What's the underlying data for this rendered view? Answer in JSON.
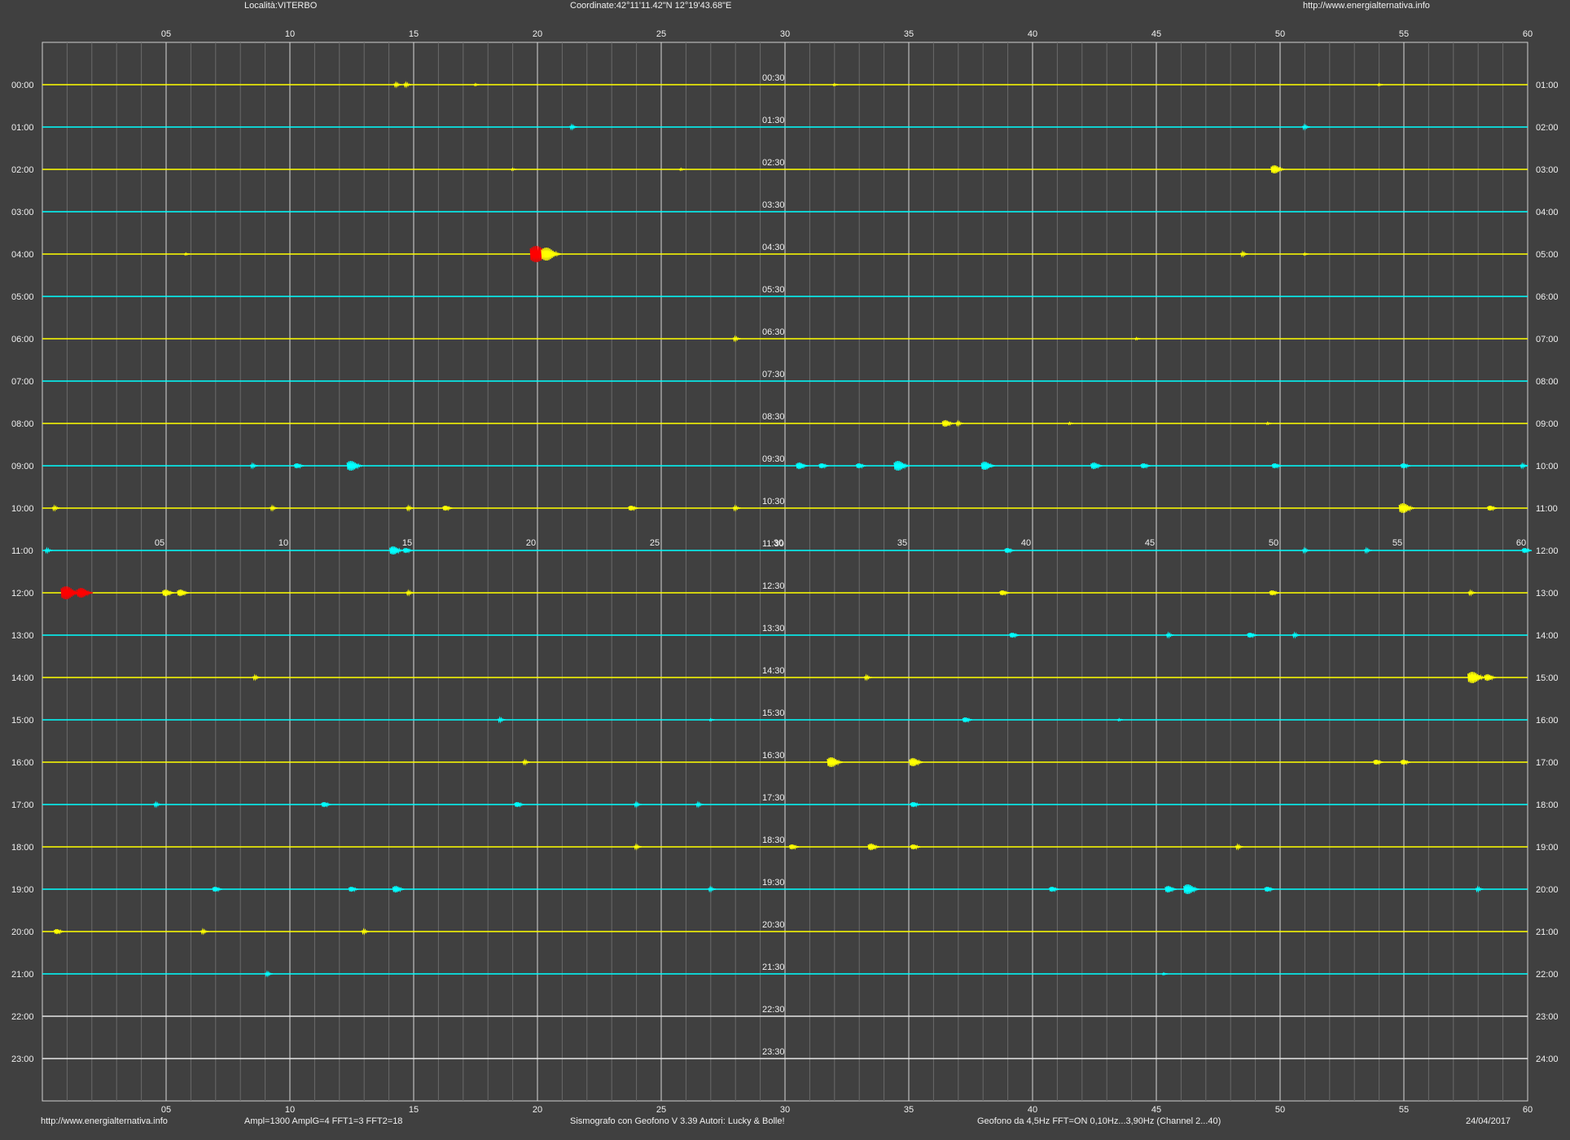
{
  "header": {
    "location": "Località:VITERBO",
    "coordinates": "Coordinate:42°11'11.42\"N  12°19'43.68\"E",
    "website": "http://www.energialternativa.info"
  },
  "footer": {
    "website": "http://www.energialternativa.info",
    "amplification": "Ampl=1300 AmplG=4 FFT1=3 FFT2=18",
    "software": "Sismografo con Geofono V 3.39  Autori: Lucky & Bolle!",
    "sensor": "Geofono da 4,5Hz FFT=ON 0,10Hz...3,90Hz      (Channel 2...40)",
    "date": "24/04/2017"
  },
  "colors": {
    "background": "#404040",
    "trace_a": "#ffff00",
    "trace_b": "#00ffff",
    "event": "#ff0000",
    "empty_trace": "#e6e6e6",
    "grid_major": "#d9d9d9",
    "grid_minor": "#6a6a6a"
  },
  "chart_data": {
    "type": "line",
    "x_tick_labels": [
      "05",
      "10",
      "15",
      "20",
      "25",
      "30",
      "35",
      "40",
      "45",
      "50",
      "55",
      "60"
    ],
    "xlim": [
      0,
      60
    ],
    "left_labels": [
      "00:00",
      "01:00",
      "02:00",
      "03:00",
      "04:00",
      "05:00",
      "06:00",
      "07:00",
      "08:00",
      "09:00",
      "10:00",
      "11:00",
      "12:00",
      "13:00",
      "14:00",
      "15:00",
      "16:00",
      "17:00",
      "18:00",
      "19:00",
      "20:00",
      "21:00",
      "22:00",
      "23:00"
    ],
    "right_labels": [
      "01:00",
      "02:00",
      "03:00",
      "04:00",
      "05:00",
      "06:00",
      "07:00",
      "08:00",
      "09:00",
      "10:00",
      "11:00",
      "12:00",
      "13:00",
      "14:00",
      "15:00",
      "16:00",
      "17:00",
      "18:00",
      "19:00",
      "20:00",
      "21:00",
      "22:00",
      "23:00",
      "24:00"
    ],
    "mid_labels": [
      "00:30",
      "01:30",
      "02:30",
      "03:30",
      "04:30",
      "05:30",
      "06:30",
      "07:30",
      "08:30",
      "09:30",
      "10:30",
      "11:30",
      "12:30",
      "13:30",
      "14:30",
      "15:30",
      "16:30",
      "17:30",
      "18:30",
      "19:30",
      "20:30",
      "21:30",
      "22:30",
      "23:30"
    ],
    "trace_colors": [
      "trace_a",
      "trace_b",
      "trace_a",
      "trace_b",
      "trace_a",
      "trace_b",
      "trace_a",
      "trace_b",
      "trace_a",
      "trace_b",
      "trace_a",
      "trace_b",
      "trace_a",
      "trace_b",
      "trace_a",
      "trace_b",
      "trace_a",
      "trace_b",
      "trace_a",
      "trace_b",
      "trace_a",
      "trace_b",
      "empty_trace",
      "empty_trace"
    ],
    "events": [
      {
        "hour": 0,
        "minute": 14.3,
        "amp": 2
      },
      {
        "hour": 0,
        "minute": 14.7,
        "amp": 2
      },
      {
        "hour": 0,
        "minute": 17.5,
        "amp": 1
      },
      {
        "hour": 0,
        "minute": 32.0,
        "amp": 1
      },
      {
        "hour": 0,
        "minute": 54.0,
        "amp": 1
      },
      {
        "hour": 1,
        "minute": 21.4,
        "amp": 2
      },
      {
        "hour": 1,
        "minute": 51.0,
        "amp": 2
      },
      {
        "hour": 2,
        "minute": 19.0,
        "amp": 1
      },
      {
        "hour": 2,
        "minute": 25.8,
        "amp": 1
      },
      {
        "hour": 2,
        "minute": 49.8,
        "amp": 5
      },
      {
        "hour": 4,
        "minute": 5.8,
        "amp": 1
      },
      {
        "hour": 4,
        "minute": 20.0,
        "amp": 10,
        "color": "event"
      },
      {
        "hour": 4,
        "minute": 20.4,
        "amp": 8
      },
      {
        "hour": 4,
        "minute": 48.5,
        "amp": 2
      },
      {
        "hour": 4,
        "minute": 51.0,
        "amp": 1
      },
      {
        "hour": 6,
        "minute": 28.0,
        "amp": 2
      },
      {
        "hour": 6,
        "minute": 44.2,
        "amp": 1
      },
      {
        "hour": 8,
        "minute": 36.5,
        "amp": 4
      },
      {
        "hour": 8,
        "minute": 37.0,
        "amp": 2
      },
      {
        "hour": 8,
        "minute": 41.5,
        "amp": 1
      },
      {
        "hour": 8,
        "minute": 49.5,
        "amp": 1
      },
      {
        "hour": 9,
        "minute": 8.5,
        "amp": 2
      },
      {
        "hour": 9,
        "minute": 10.3,
        "amp": 3
      },
      {
        "hour": 9,
        "minute": 12.5,
        "amp": 6
      },
      {
        "hour": 9,
        "minute": 30.6,
        "amp": 4
      },
      {
        "hour": 9,
        "minute": 31.5,
        "amp": 3
      },
      {
        "hour": 9,
        "minute": 33.0,
        "amp": 3
      },
      {
        "hour": 9,
        "minute": 34.6,
        "amp": 6
      },
      {
        "hour": 9,
        "minute": 38.1,
        "amp": 5
      },
      {
        "hour": 9,
        "minute": 42.5,
        "amp": 4
      },
      {
        "hour": 9,
        "minute": 44.5,
        "amp": 3
      },
      {
        "hour": 9,
        "minute": 49.8,
        "amp": 3
      },
      {
        "hour": 9,
        "minute": 55.0,
        "amp": 3
      },
      {
        "hour": 9,
        "minute": 59.8,
        "amp": 2
      },
      {
        "hour": 10,
        "minute": 0.5,
        "amp": 2
      },
      {
        "hour": 10,
        "minute": 9.3,
        "amp": 2
      },
      {
        "hour": 10,
        "minute": 14.8,
        "amp": 2
      },
      {
        "hour": 10,
        "minute": 16.3,
        "amp": 3
      },
      {
        "hour": 10,
        "minute": 23.8,
        "amp": 3
      },
      {
        "hour": 10,
        "minute": 28.0,
        "amp": 2
      },
      {
        "hour": 10,
        "minute": 55.0,
        "amp": 6
      },
      {
        "hour": 10,
        "minute": 58.5,
        "amp": 3
      },
      {
        "hour": 11,
        "minute": 0.2,
        "amp": 2
      },
      {
        "hour": 11,
        "minute": 14.2,
        "amp": 5
      },
      {
        "hour": 11,
        "minute": 14.7,
        "amp": 3
      },
      {
        "hour": 11,
        "minute": 39.0,
        "amp": 3
      },
      {
        "hour": 11,
        "minute": 51.0,
        "amp": 2
      },
      {
        "hour": 11,
        "minute": 53.5,
        "amp": 2
      },
      {
        "hour": 11,
        "minute": 59.9,
        "amp": 3
      },
      {
        "hour": 12,
        "minute": 1.0,
        "amp": 8,
        "color": "event"
      },
      {
        "hour": 12,
        "minute": 1.6,
        "amp": 6,
        "color": "event"
      },
      {
        "hour": 12,
        "minute": 5.0,
        "amp": 4
      },
      {
        "hour": 12,
        "minute": 5.6,
        "amp": 4
      },
      {
        "hour": 12,
        "minute": 14.8,
        "amp": 2
      },
      {
        "hour": 12,
        "minute": 38.8,
        "amp": 3
      },
      {
        "hour": 12,
        "minute": 49.7,
        "amp": 3
      },
      {
        "hour": 12,
        "minute": 57.7,
        "amp": 2
      },
      {
        "hour": 13,
        "minute": 39.2,
        "amp": 3
      },
      {
        "hour": 13,
        "minute": 45.5,
        "amp": 2
      },
      {
        "hour": 13,
        "minute": 48.8,
        "amp": 3
      },
      {
        "hour": 13,
        "minute": 50.6,
        "amp": 2
      },
      {
        "hour": 14,
        "minute": 8.6,
        "amp": 2
      },
      {
        "hour": 14,
        "minute": 33.3,
        "amp": 2
      },
      {
        "hour": 14,
        "minute": 57.8,
        "amp": 7
      },
      {
        "hour": 14,
        "minute": 58.4,
        "amp": 4
      },
      {
        "hour": 15,
        "minute": 18.5,
        "amp": 2
      },
      {
        "hour": 15,
        "minute": 27.0,
        "amp": 1
      },
      {
        "hour": 15,
        "minute": 37.3,
        "amp": 3
      },
      {
        "hour": 15,
        "minute": 43.5,
        "amp": 1
      },
      {
        "hour": 16,
        "minute": 19.5,
        "amp": 2
      },
      {
        "hour": 16,
        "minute": 31.9,
        "amp": 6
      },
      {
        "hour": 16,
        "minute": 35.2,
        "amp": 5
      },
      {
        "hour": 16,
        "minute": 53.9,
        "amp": 3
      },
      {
        "hour": 16,
        "minute": 55.0,
        "amp": 3
      },
      {
        "hour": 17,
        "minute": 4.6,
        "amp": 2
      },
      {
        "hour": 17,
        "minute": 11.4,
        "amp": 3
      },
      {
        "hour": 17,
        "minute": 19.2,
        "amp": 3
      },
      {
        "hour": 17,
        "minute": 24.0,
        "amp": 2
      },
      {
        "hour": 17,
        "minute": 26.5,
        "amp": 2
      },
      {
        "hour": 17,
        "minute": 35.2,
        "amp": 3
      },
      {
        "hour": 18,
        "minute": 24.0,
        "amp": 2
      },
      {
        "hour": 18,
        "minute": 30.3,
        "amp": 3
      },
      {
        "hour": 18,
        "minute": 33.5,
        "amp": 4
      },
      {
        "hour": 18,
        "minute": 35.2,
        "amp": 3
      },
      {
        "hour": 18,
        "minute": 48.3,
        "amp": 2
      },
      {
        "hour": 19,
        "minute": 7.0,
        "amp": 3
      },
      {
        "hour": 19,
        "minute": 12.5,
        "amp": 3
      },
      {
        "hour": 19,
        "minute": 14.3,
        "amp": 4
      },
      {
        "hour": 19,
        "minute": 27.0,
        "amp": 2
      },
      {
        "hour": 19,
        "minute": 40.8,
        "amp": 3
      },
      {
        "hour": 19,
        "minute": 45.5,
        "amp": 4
      },
      {
        "hour": 19,
        "minute": 46.3,
        "amp": 6
      },
      {
        "hour": 19,
        "minute": 49.5,
        "amp": 3
      },
      {
        "hour": 19,
        "minute": 58.0,
        "amp": 2
      },
      {
        "hour": 20,
        "minute": 0.6,
        "amp": 3
      },
      {
        "hour": 20,
        "minute": 6.5,
        "amp": 2
      },
      {
        "hour": 20,
        "minute": 13.0,
        "amp": 2
      },
      {
        "hour": 21,
        "minute": 9.1,
        "amp": 2
      },
      {
        "hour": 21,
        "minute": 45.3,
        "amp": 1
      }
    ]
  }
}
